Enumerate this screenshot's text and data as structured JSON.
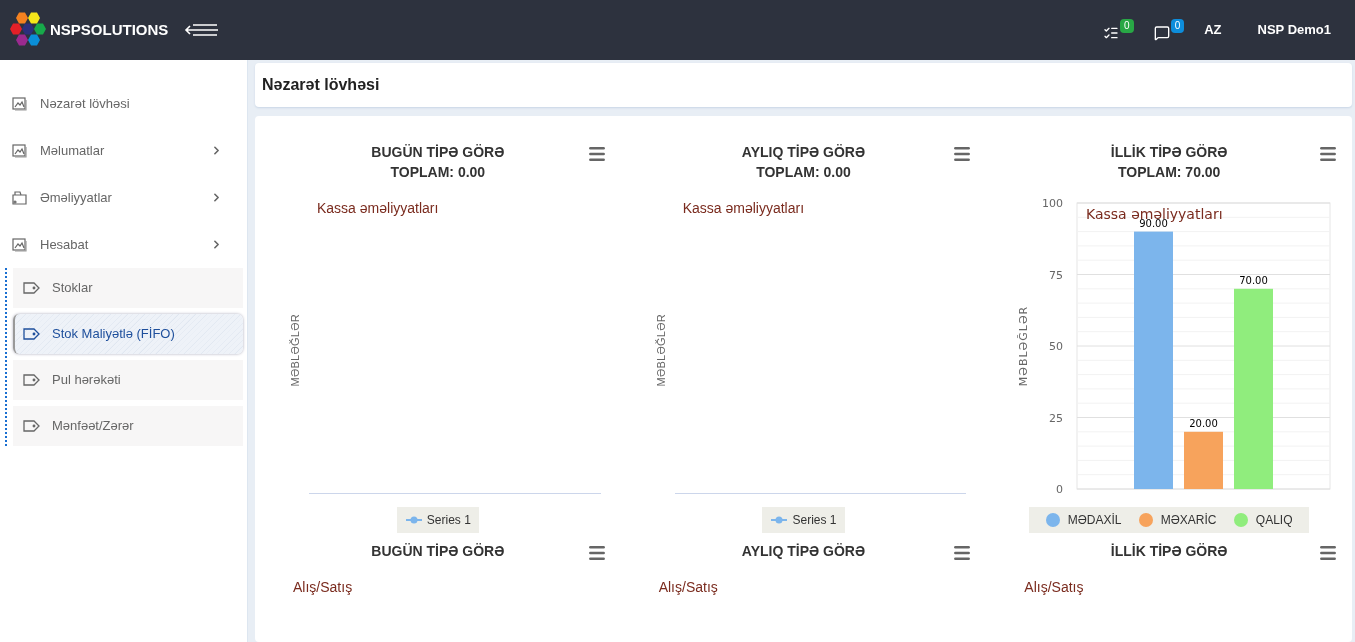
{
  "header": {
    "brand": "NSPSOLUTIONS",
    "notifications": [
      {
        "kind": "tasks",
        "count": "0",
        "color": "#28a745"
      },
      {
        "kind": "messages",
        "count": "0",
        "color": "#0d8ddb"
      }
    ],
    "language": "AZ",
    "user": "NSP Demo1"
  },
  "sidebar": {
    "items": [
      {
        "label": "Nəzarət lövhəsi",
        "kind": "chart",
        "expandable": false
      },
      {
        "label": "Məlumatlar",
        "kind": "chart",
        "expandable": true
      },
      {
        "label": "Əməliyyatlar",
        "kind": "folder",
        "expandable": true
      },
      {
        "label": "Hesabat",
        "kind": "chart",
        "expandable": true,
        "children": [
          {
            "label": "Stoklar",
            "selected": false
          },
          {
            "label": "Stok Maliyətlə (FİFO)",
            "selected": true
          },
          {
            "label": "Pul hərəkəti",
            "selected": false
          },
          {
            "label": "Mənfəət/Zərər",
            "selected": false
          }
        ]
      }
    ]
  },
  "page_title": "Nəzarət lövhəsi",
  "charts": [
    {
      "kind": "empty",
      "title": "BUGÜN TİPƏ GÖRƏ",
      "total": "TOPLAM: 0.00",
      "subtitle": "Kassa əməliyyatları",
      "ylabel": "MƏBLƏĞLƏR",
      "legend": "Series 1"
    },
    {
      "kind": "empty",
      "title": "AYLIQ TİPƏ GÖRƏ",
      "total": "TOPLAM: 0.00",
      "subtitle": "Kassa əməliyyatları",
      "ylabel": "MƏBLƏĞLƏR",
      "legend": "Series 1"
    },
    {
      "kind": "bar",
      "title": "İLLİK TİPƏ GÖRƏ",
      "total": "TOPLAM: 70.00",
      "chart_data": {
        "type": "bar",
        "title": "Kassa əməliyyatları",
        "ylabel": "MƏBLƏĞLƏR",
        "ylim": [
          0,
          100
        ],
        "grid": true,
        "yticks": [
          0,
          25,
          50,
          75,
          100
        ],
        "value_labels": [
          "90.00",
          "20.00",
          "70.00"
        ],
        "series": [
          {
            "name": "MƏDAXİL",
            "color": "#7cb5ec",
            "values": [
              90
            ]
          },
          {
            "name": "MƏXARİC",
            "color": "#f7a35c",
            "values": [
              20
            ]
          },
          {
            "name": "QALIQ",
            "color": "#90ed7d",
            "values": [
              70
            ]
          }
        ]
      }
    },
    {
      "kind": "cut",
      "title": "BUGÜN TİPƏ GÖRƏ",
      "subtitle": "Alış/Satış"
    },
    {
      "kind": "cut",
      "title": "AYLIQ TİPƏ GÖRƏ",
      "subtitle": "Alış/Satış"
    },
    {
      "kind": "cut",
      "title": "İLLİK TİPƏ GÖRƏ",
      "subtitle": "Alış/Satış"
    }
  ]
}
